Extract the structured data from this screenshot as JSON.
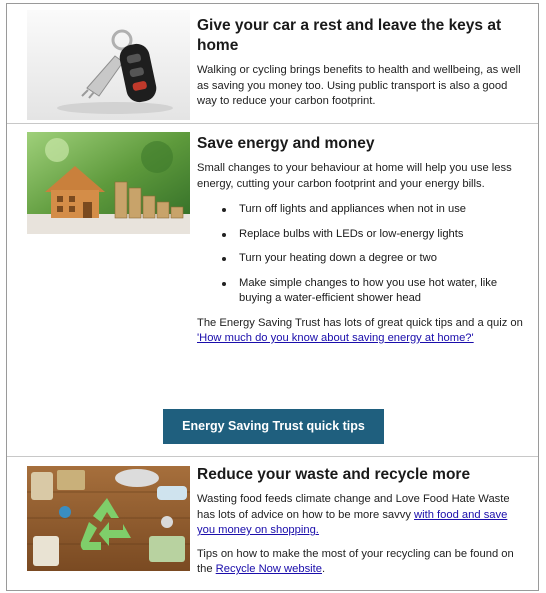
{
  "sections": [
    {
      "title": "Give your car a rest and leave the keys at home",
      "image_icon": "car-keys-image",
      "body": "Walking or cycling brings benefits to health and wellbeing, as well as saving you money too. Using public transport is also a good way to reduce your carbon footprint."
    },
    {
      "title": "Save energy and money",
      "image_icon": "house-coins-image",
      "intro": "Small changes to your behaviour at home will help you use less energy, cutting your carbon footprint and your energy bills.",
      "bullets": [
        "Turn off lights and appliances when not in use",
        "Replace bulbs with LEDs or low-energy lights",
        "Turn your heating down a degree or two",
        "Make simple changes to how you use hot water, like buying a water-efficient shower head"
      ],
      "quiz_text": "The Energy Saving Trust has lots of great quick tips and a quiz on ",
      "quiz_link": "'How much do you know about saving energy at home?'",
      "button_label": "Energy Saving Trust quick tips"
    },
    {
      "title": "Reduce your waste and recycle more",
      "image_icon": "recycling-image",
      "body_text": "Wasting food feeds climate change and Love Food Hate Waste has lots of advice on how to be more savvy ",
      "body_link": "with food and save you money on shopping.",
      "tips_text": "Tips on how to make the most of your recycling can be found on the ",
      "tips_link": "Recycle Now website",
      "tips_end": "."
    }
  ],
  "colors": {
    "button": "#1f5f7e",
    "link": "#1a0dab",
    "recycle_symbol": "#7fce6a"
  }
}
